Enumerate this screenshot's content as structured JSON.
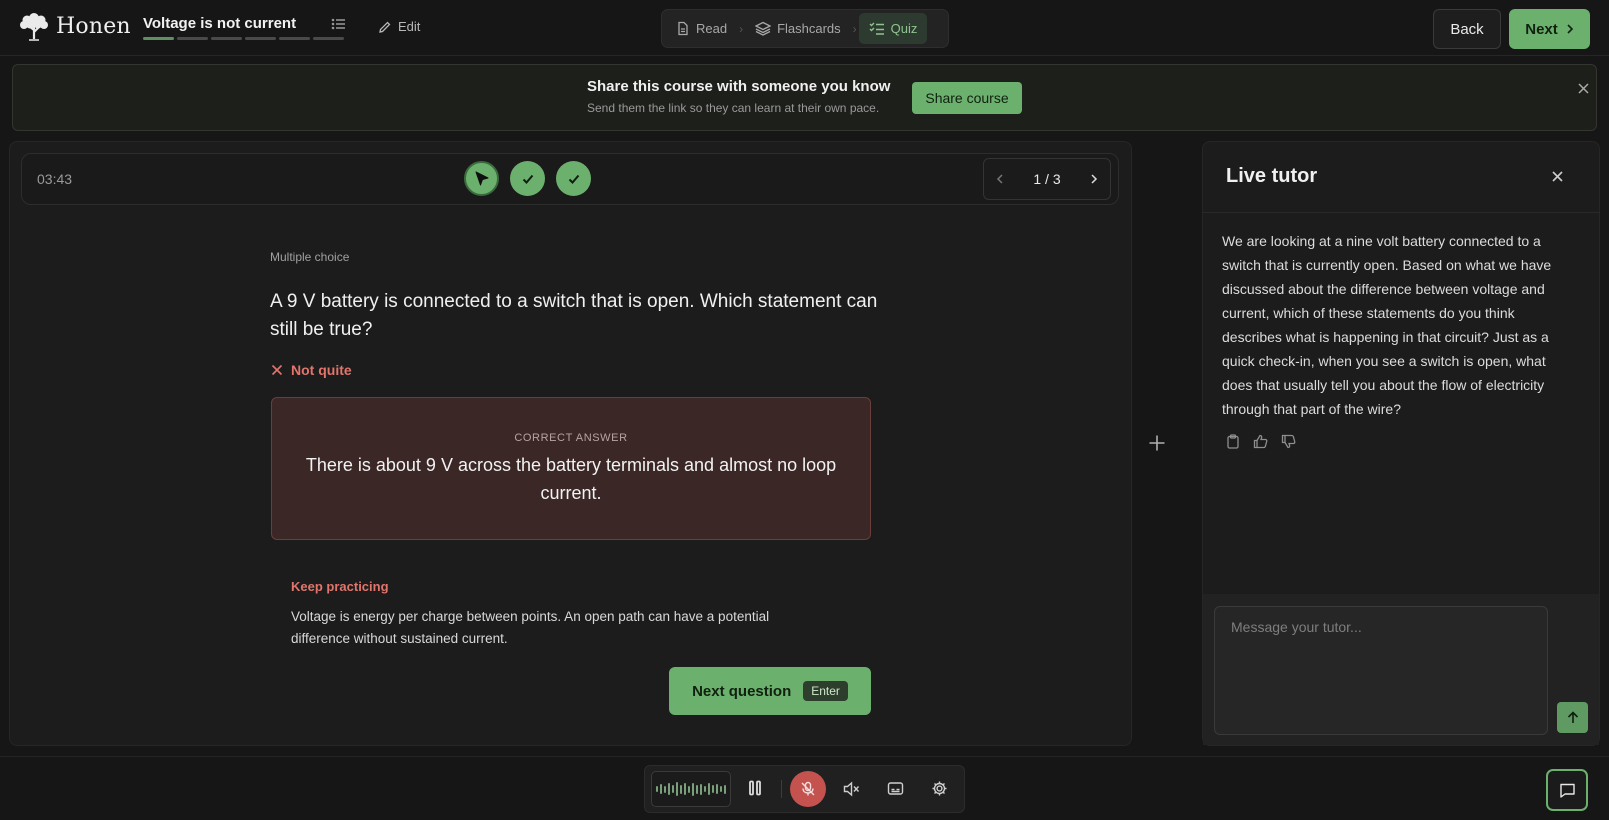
{
  "app": {
    "name": "Honen"
  },
  "course": {
    "title": "Voltage is not current",
    "progress_total": 6,
    "progress_done": 1
  },
  "header": {
    "edit_label": "Edit",
    "back_label": "Back",
    "next_label": "Next"
  },
  "mode_tabs": [
    {
      "label": "Read",
      "icon": "document-icon",
      "active": false
    },
    {
      "label": "Flashcards",
      "icon": "layers-icon",
      "active": false
    },
    {
      "label": "Quiz",
      "icon": "checklist-icon",
      "active": true
    }
  ],
  "banner": {
    "title": "Share this course with someone you know",
    "subtitle": "Send them the link so they can learn at their own pace.",
    "button_label": "Share course"
  },
  "quiz": {
    "timer": "03:43",
    "questions_status": [
      "current",
      "correct",
      "correct"
    ],
    "pager": "1 / 3",
    "question_type": "Multiple choice",
    "question": "A 9 V battery is connected to a switch that is open. Which statement can still be true?",
    "verdict": "Not quite",
    "correct_label": "CORRECT ANSWER",
    "correct_answer": "There is about 9 V across the battery terminals and almost no loop current.",
    "feedback_title": "Keep practicing",
    "feedback_text": "Voltage is energy per charge between points. An open path can have a potential difference without sustained current.",
    "next_question_label": "Next question",
    "next_question_key": "Enter"
  },
  "tutor": {
    "title": "Live tutor",
    "message": "We are looking at a nine volt battery connected to a switch that is currently open. Based on what we have discussed about the difference between voltage and current, which of these statements do you think describes what is happening in that circuit? Just as a quick check-in, when you see a switch is open, what does that usually tell you about the flow of electricity through that part of the wire?",
    "input_placeholder": "Message your tutor..."
  },
  "colors": {
    "accent": "#6cb06e",
    "error": "#e0756c",
    "mic_muted": "#c4524e",
    "answer_bg": "#3a2726"
  }
}
